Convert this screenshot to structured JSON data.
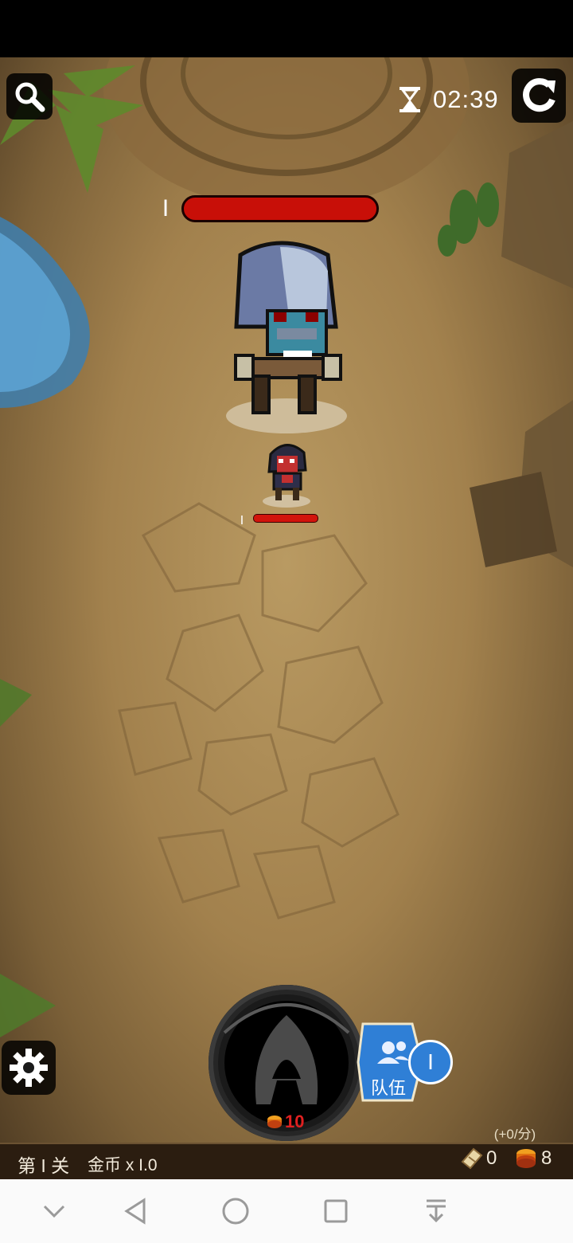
{
  "hud": {
    "timer": "02:39",
    "boss_level": "I",
    "hero_level": "I"
  },
  "summon": {
    "cost": "10"
  },
  "team": {
    "label": "队伍",
    "count": "I"
  },
  "income_rate": "(+0/分)",
  "bottom": {
    "stage": "第 I 关",
    "coin_multiplier": "金币 x I.0",
    "tickets": "0",
    "coins": "8"
  },
  "icons": {
    "search": "search-icon",
    "hourglass": "hourglass-icon",
    "restart": "restart-icon",
    "settings": "gear-icon",
    "team": "people-icon",
    "ticket": "ticket-icon",
    "coin": "coin-stack-icon",
    "nav": [
      "chevron-down-icon",
      "back-triangle-icon",
      "home-circle-icon",
      "recents-square-icon",
      "download-icon"
    ]
  },
  "colors": {
    "boss_hp": "#c80f08",
    "hero_hp": "#d2140c",
    "team_blue": "#2f7fd6",
    "summon_cost": "#e02020"
  }
}
